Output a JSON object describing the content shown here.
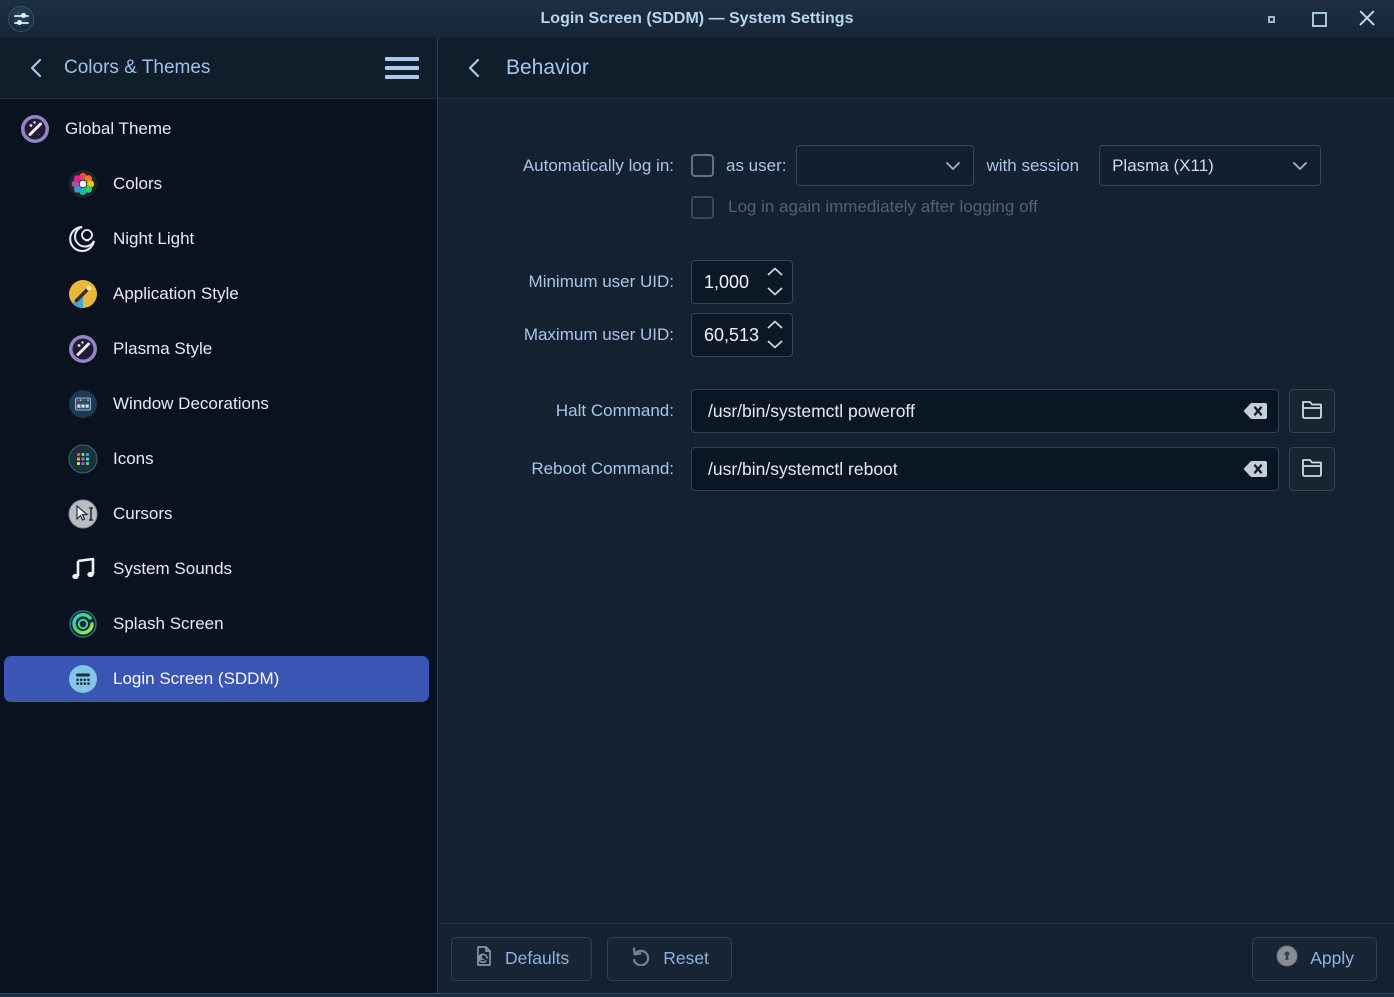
{
  "window": {
    "title": "Login Screen (SDDM) — System Settings"
  },
  "titlebar_icons": {
    "app_icon": "settings-sliders-icon",
    "minimize": "minimize-icon",
    "maximize": "maximize-icon",
    "close": "close-icon"
  },
  "sidebar": {
    "header_title": "Colors & Themes",
    "items": [
      {
        "label": "Global Theme",
        "icon": "global-theme-icon",
        "indent": 0,
        "selected": false
      },
      {
        "label": "Colors",
        "icon": "colors-icon",
        "indent": 1,
        "selected": false
      },
      {
        "label": "Night Light",
        "icon": "night-light-icon",
        "indent": 1,
        "selected": false
      },
      {
        "label": "Application Style",
        "icon": "application-style-icon",
        "indent": 1,
        "selected": false
      },
      {
        "label": "Plasma Style",
        "icon": "plasma-style-icon",
        "indent": 1,
        "selected": false
      },
      {
        "label": "Window Decorations",
        "icon": "window-decorations-icon",
        "indent": 1,
        "selected": false
      },
      {
        "label": "Icons",
        "icon": "icons-icon",
        "indent": 1,
        "selected": false
      },
      {
        "label": "Cursors",
        "icon": "cursors-icon",
        "indent": 1,
        "selected": false
      },
      {
        "label": "System Sounds",
        "icon": "system-sounds-icon",
        "indent": 1,
        "selected": false
      },
      {
        "label": "Splash Screen",
        "icon": "splash-screen-icon",
        "indent": 1,
        "selected": false
      },
      {
        "label": "Login Screen (SDDM)",
        "icon": "login-screen-icon",
        "indent": 1,
        "selected": true
      }
    ]
  },
  "main": {
    "header_title": "Behavior",
    "form": {
      "autologin": {
        "label": "Automatically log in:",
        "checked": false,
        "as_user_label": "as user:",
        "user_value": "",
        "with_session_label": "with session",
        "session_value": "Plasma (X11)"
      },
      "relogin": {
        "label": "Log in again immediately after logging off",
        "checked": false,
        "enabled": false
      },
      "min_uid": {
        "label": "Minimum user UID:",
        "value": "1,000"
      },
      "max_uid": {
        "label": "Maximum user UID:",
        "value": "60,513"
      },
      "halt": {
        "label": "Halt Command:",
        "value": "/usr/bin/systemctl poweroff"
      },
      "reboot": {
        "label": "Reboot Command:",
        "value": "/usr/bin/systemctl reboot"
      }
    },
    "footer": {
      "defaults_label": "Defaults",
      "reset_label": "Reset",
      "apply_label": "Apply"
    }
  },
  "colors": {
    "accent_selection": "#3a55b4",
    "sidebar_bg": "#0a1220",
    "content_bg": "#132130",
    "header_bg": "#101d2b",
    "titlebar_bg": "#1a2b3d",
    "label_text": "#a7c6e9",
    "disabled_text": "#4c637c",
    "field_bg": "#0a1624",
    "field_border": "#2d4156"
  }
}
